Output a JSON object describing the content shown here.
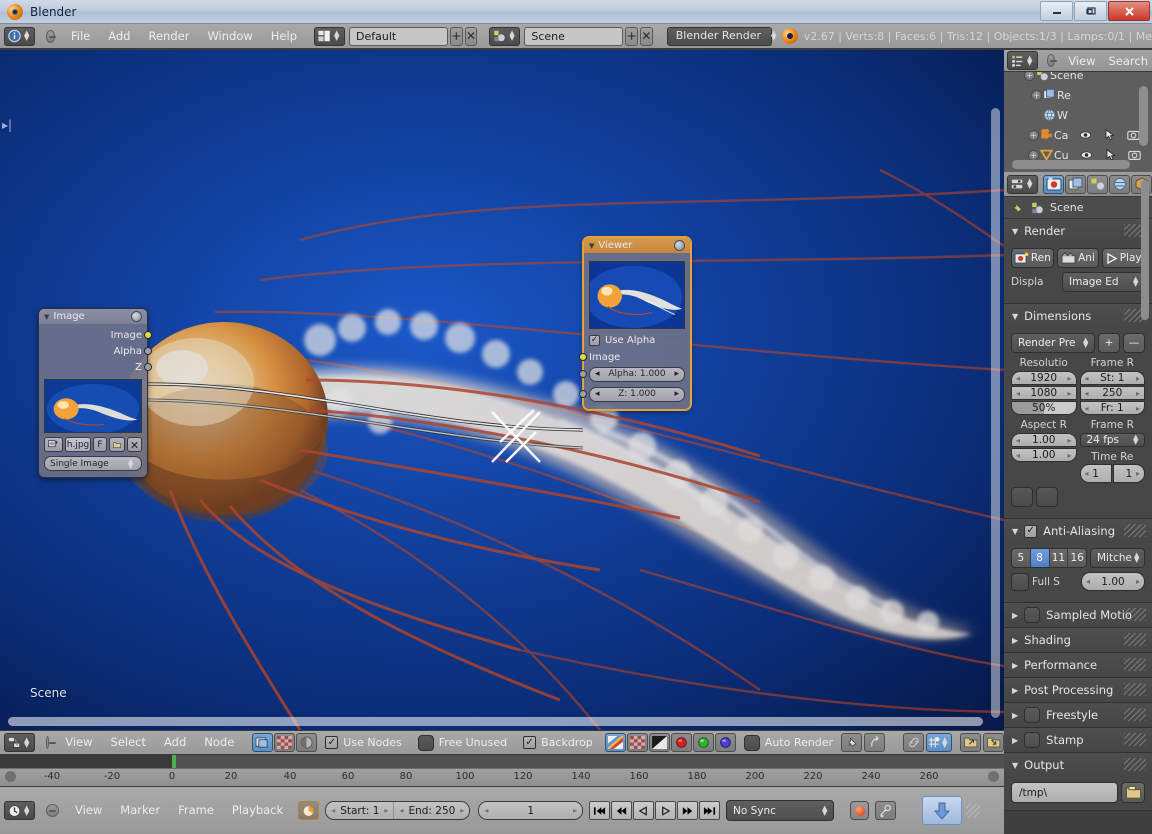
{
  "window": {
    "title": "Blender",
    "app_icon": "blender-logo-icon",
    "minimize_label": "—",
    "maximize_label": "❐",
    "close_label": "✕"
  },
  "topbar": {
    "editor_icon": "info-editor-icon",
    "collapse_icon": "collapse-menu-icon",
    "menus": [
      "File",
      "Add",
      "Render",
      "Window",
      "Help"
    ],
    "screen_layout_icon": "screen-layout-icon",
    "screen_layout_value": "Default",
    "screen_add_label": "+",
    "screen_del_label": "✕",
    "scene_icon": "scene-data-icon",
    "scene_value": "Scene",
    "scene_add_label": "+",
    "scene_del_label": "✕",
    "render_engine_value": "Blender Render",
    "version_logo": "blender-logo-icon",
    "stats": "v2.67 | Verts:8 | Faces:6 | Tris:12 | Objects:1/3 | Lamps:0/1 | Me"
  },
  "viewport": {
    "scene_label": "Scene",
    "left_arrow_icon": "panel-expand-arrow-icon",
    "backdrop_description": "jellyfish-backdrop-image"
  },
  "nodes": [
    {
      "id": "image-node",
      "title": "Image",
      "selected": false,
      "outputs": [
        "Image",
        "Alpha",
        "Z"
      ],
      "preview": "jellyfish-thumbnail",
      "buttons": {
        "browse_icon": "browse-image-icon",
        "name": "h.jpg",
        "fake_user": "F",
        "open_icon": "open-file-icon",
        "unlink_icon": "unlink-icon"
      },
      "source_dropdown": "Single Image"
    },
    {
      "id": "viewer-node",
      "title": "Viewer",
      "selected": true,
      "preview": "jellyfish-thumbnail",
      "use_alpha_label": "Use Alpha",
      "use_alpha_checked": true,
      "inputs": [
        "Image"
      ],
      "alpha_value": "Alpha: 1.000",
      "z_value": "Z: 1.000"
    }
  ],
  "outliner": {
    "editor_icon": "outliner-editor-icon",
    "collapse_icon": "collapse-menu-icon",
    "menus": [
      "View",
      "Search"
    ],
    "rows": [
      {
        "icon": "scene-icon",
        "label": "Scene",
        "expander": true
      },
      {
        "icon": "renderlayers-icon",
        "label": "Re",
        "expander": true
      },
      {
        "icon": "world-icon",
        "label": "W",
        "expander": false
      },
      {
        "icon": "camera-icon",
        "label": "Ca",
        "expander": true,
        "eye": true,
        "cursor": true,
        "render": true
      },
      {
        "icon": "mesh-cube-icon",
        "label": "Cu",
        "expander": true,
        "eye": true,
        "cursor": true,
        "render": true
      }
    ]
  },
  "properties": {
    "editor_icon": "properties-editor-icon",
    "tabs": [
      {
        "name": "render-tab",
        "icon": "camera-back-icon",
        "active": true
      },
      {
        "name": "render-layers-tab",
        "icon": "render-layers-icon",
        "active": false
      },
      {
        "name": "scene-tab",
        "icon": "scene-icon",
        "active": false
      },
      {
        "name": "world-tab",
        "icon": "world-globe-icon",
        "active": false
      },
      {
        "name": "object-tab",
        "icon": "object-icon",
        "active": false
      }
    ],
    "id_row": {
      "pin_icon": "pin-icon",
      "scene_icon": "scene-data-icon",
      "scene_name": "Scene"
    },
    "panels": [
      {
        "name": "render",
        "title": "Render",
        "open": true,
        "render_button": "Ren",
        "animation_button": "Ani",
        "play_button": "Play",
        "display_label": "Displa",
        "display_value": "Image Ed"
      },
      {
        "name": "dimensions",
        "title": "Dimensions",
        "open": true,
        "preset_value": "Render Pre",
        "preset_add": "+",
        "preset_remove": "—",
        "resolution_label": "Resolutio",
        "resolution_x": "1920",
        "resolution_y": "1080",
        "resolution_pct": "50%",
        "frame_range_label": "Frame R",
        "frame_start": "St: 1",
        "frame_end": "250",
        "frame_step": "Fr: 1",
        "aspect_label": "Aspect R",
        "aspect_x": "1.00",
        "aspect_y": "1.00",
        "framerate_label": "Frame R",
        "framerate_value": "24 fps",
        "timeremap_label": "Time Re",
        "time_old": "1",
        "time_new": "1"
      },
      {
        "name": "anti-aliasing",
        "title": "Anti-Aliasing",
        "open": true,
        "checked": true,
        "samples": [
          "5",
          "8",
          "11",
          "16"
        ],
        "samples_active_index": 1,
        "filter_value": "Mitche",
        "full_sample_label": "Full S",
        "filter_size": "1.00"
      },
      {
        "name": "sampled-motion-blur",
        "title": "Sampled Motio",
        "open": false,
        "has_checkbox": true
      },
      {
        "name": "shading",
        "title": "Shading",
        "open": false
      },
      {
        "name": "performance",
        "title": "Performance",
        "open": false
      },
      {
        "name": "post-processing",
        "title": "Post Processing",
        "open": false
      },
      {
        "name": "freestyle",
        "title": "Freestyle",
        "open": false,
        "has_checkbox": true
      },
      {
        "name": "stamp",
        "title": "Stamp",
        "open": false,
        "has_checkbox": true
      },
      {
        "name": "output",
        "title": "Output",
        "open": true,
        "output_path": "/tmp\\",
        "folder_icon": "folder-browse-icon"
      }
    ]
  },
  "node_header": {
    "editor_icon": "node-editor-icon",
    "collapse_icon": "collapse-menu-icon",
    "menus": [
      "View",
      "Select",
      "Add",
      "Node"
    ],
    "type_icons": [
      "compositing-icon",
      "texture-icon",
      "material-icon"
    ],
    "use_nodes_label": "Use Nodes",
    "use_nodes_checked": true,
    "free_unused_label": "Free Unused",
    "free_unused_checked": false,
    "backdrop_label": "Backdrop",
    "backdrop_checked": true,
    "channel_icons": [
      "color-channel-icon",
      "alpha-channel-icon",
      "bw-channel-icon"
    ],
    "channel_rgb": [
      "red-channel-icon",
      "green-channel-icon",
      "blue-channel-icon"
    ],
    "auto_render_label": "Auto Render",
    "auto_render_checked": false,
    "pin_icon": "pin-icon",
    "go_parent_icon": "go-to-parent-icon",
    "link_icon": "link-icon",
    "snap_icon": "snap-icon",
    "copy_icon": "copy-icon",
    "paste_icon": "paste-icon"
  },
  "timeline": {
    "editor_icon": "timeline-editor-icon",
    "collapse_icon": "collapse-menu-icon",
    "menus": [
      "View",
      "Marker",
      "Frame",
      "Playback"
    ],
    "use_preview_icon": "preview-range-icon",
    "start_label": "Start: 1",
    "end_label": "End: 250",
    "current_frame": "1",
    "transport": [
      "jump-start-icon",
      "prev-keyframe-icon",
      "play-reverse-icon",
      "play-icon",
      "next-keyframe-icon",
      "jump-end-icon"
    ],
    "sync_value": "No Sync",
    "record_icon": "record-icon",
    "keyframe_icon": "auto-keyframe-icon",
    "download_icon": "download-icon",
    "ruler_ticks": [
      "-40",
      "-20",
      "0",
      "20",
      "40",
      "60",
      "80",
      "100",
      "120",
      "140",
      "160",
      "180",
      "200",
      "220",
      "240",
      "260"
    ],
    "playhead_frame": "1"
  }
}
